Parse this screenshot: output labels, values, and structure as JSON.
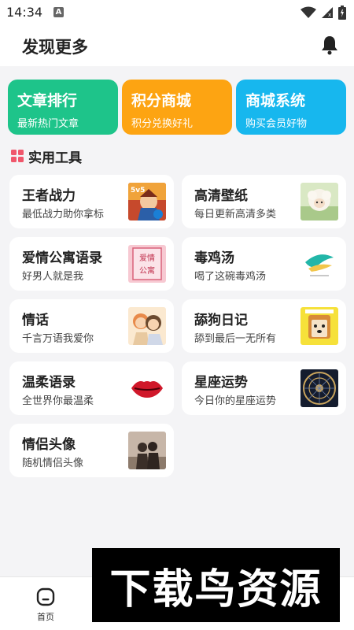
{
  "status_bar": {
    "time": "14:34",
    "notification_letter": "A"
  },
  "header": {
    "title": "发现更多"
  },
  "top_cards": [
    {
      "title": "文章排行",
      "subtitle": "最新热门文章",
      "color": "#1ec48a"
    },
    {
      "title": "积分商城",
      "subtitle": "积分兑换好礼",
      "color": "#fda412"
    },
    {
      "title": "商城系统",
      "subtitle": "购买会员好物",
      "color": "#17b7ee"
    }
  ],
  "section": {
    "title": "实用工具",
    "icon_color": "#f0566b"
  },
  "tools": [
    {
      "title": "王者战力",
      "subtitle": "最低战力助你拿标",
      "thumb": "game-hero-thumbnail"
    },
    {
      "title": "高清壁纸",
      "subtitle": "每日更新高清多类",
      "thumb": "wallpaper-sheep-thumbnail"
    },
    {
      "title": "爱情公寓语录",
      "subtitle": "好男人就是我",
      "thumb": "love-apartment-thumbnail"
    },
    {
      "title": "毒鸡汤",
      "subtitle": "喝了这碗毒鸡汤",
      "thumb": "soup-logo-thumbnail"
    },
    {
      "title": "情话",
      "subtitle": "千言万语我爱你",
      "thumb": "couple-cartoon-thumbnail"
    },
    {
      "title": "舔狗日记",
      "subtitle": "舔到最后一无所有",
      "thumb": "dog-cartoon-thumbnail"
    },
    {
      "title": "温柔语录",
      "subtitle": "全世界你最温柔",
      "thumb": "lips-thumbnail"
    },
    {
      "title": "星座运势",
      "subtitle": "今日你的星座运势",
      "thumb": "zodiac-wheel-thumbnail"
    },
    {
      "title": "情侣头像",
      "subtitle": "随机情侣头像",
      "thumb": "couple-silhouette-thumbnail"
    }
  ],
  "bottom_nav": {
    "home_label": "首页"
  },
  "watermark": {
    "text": "下载鸟资源"
  }
}
